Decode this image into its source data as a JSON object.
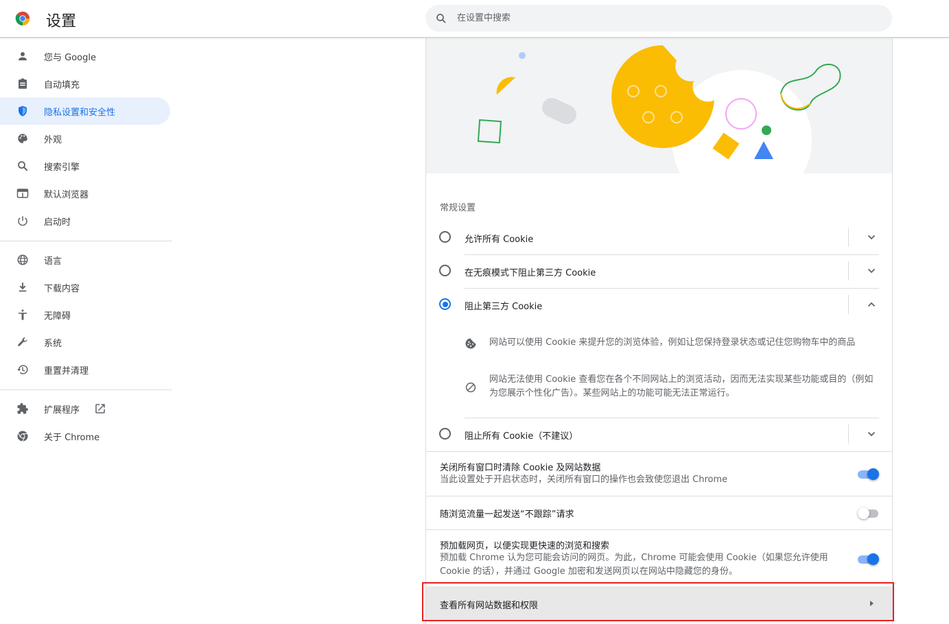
{
  "header": {
    "title": "设置",
    "search_placeholder": "在设置中搜索"
  },
  "sidebar": {
    "items": [
      {
        "label": "您与 Google",
        "icon": "person-icon"
      },
      {
        "label": "自动填充",
        "icon": "clipboard-icon"
      },
      {
        "label": "隐私设置和安全性",
        "icon": "shield-icon",
        "active": true
      },
      {
        "label": "外观",
        "icon": "palette-icon"
      },
      {
        "label": "搜索引擎",
        "icon": "search-icon"
      },
      {
        "label": "默认浏览器",
        "icon": "browser-icon"
      },
      {
        "label": "启动时",
        "icon": "power-icon"
      },
      {
        "label": "语言",
        "icon": "globe-icon"
      },
      {
        "label": "下载内容",
        "icon": "download-icon"
      },
      {
        "label": "无障碍",
        "icon": "accessibility-icon"
      },
      {
        "label": "系统",
        "icon": "wrench-icon"
      },
      {
        "label": "重置并清理",
        "icon": "history-icon"
      },
      {
        "label": "扩展程序",
        "icon": "puzzle-icon"
      },
      {
        "label": "关于 Chrome",
        "icon": "chrome-icon"
      }
    ]
  },
  "cookies": {
    "section_title": "常规设置",
    "options": [
      {
        "label": "允许所有 Cookie",
        "checked": false,
        "expanded": false
      },
      {
        "label": "在无痕模式下阻止第三方 Cookie",
        "checked": false,
        "expanded": false
      },
      {
        "label": "阻止第三方 Cookie",
        "checked": true,
        "expanded": true
      },
      {
        "label": "阻止所有 Cookie（不建议）",
        "checked": false,
        "expanded": false
      }
    ],
    "details": [
      {
        "text": "网站可以使用 Cookie 来提升您的浏览体验，例如让您保持登录状态或记住您购物车中的商品",
        "icon": "cookie-icon"
      },
      {
        "text": "网站无法使用 Cookie 查看您在各个不同网站上的浏览活动，因而无法实现某些功能或目的（例如为您展示个性化广告）。某些网站上的功能可能无法正常运行。",
        "icon": "block-icon"
      }
    ]
  },
  "toggles": [
    {
      "title": "关闭所有窗口时清除 Cookie 及网站数据",
      "subtitle": "当此设置处于开启状态时，关闭所有窗口的操作也会致使您退出 Chrome",
      "on": true
    },
    {
      "title": "随浏览流量一起发送“不跟踪”请求",
      "subtitle": "",
      "on": false
    },
    {
      "title": "预加载网页，以便实现更快速的浏览和搜索",
      "subtitle": "预加载 Chrome 认为您可能会访问的网页。为此，Chrome 可能会使用 Cookie（如果您允许使用 Cookie 的话），并通过 Google 加密和发送网页以在网站中隐藏您的身份。",
      "on": true
    }
  ],
  "site_data_link": {
    "label": "查看所有网站数据和权限"
  },
  "colors": {
    "accent": "#1a73e8",
    "highlight_border": "#e8211f",
    "active_bg": "#e8f0fe"
  }
}
